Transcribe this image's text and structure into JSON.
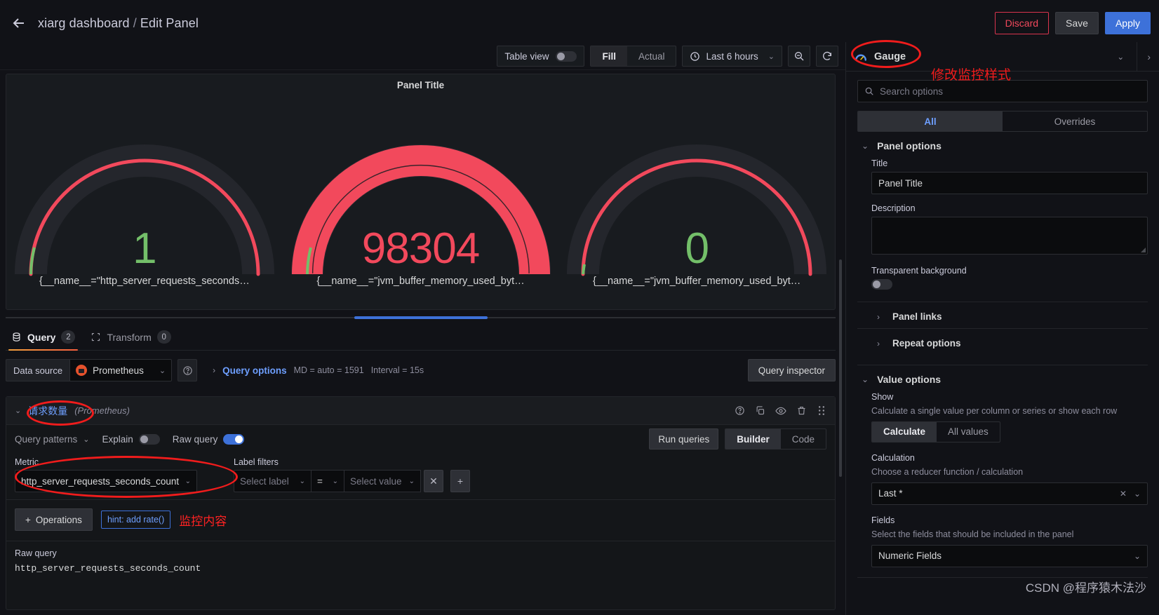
{
  "topnav": {
    "back_icon": "arrow-left-icon",
    "breadcrumb_dashboard": "xiarg dashboard",
    "breadcrumb_sep": " / ",
    "breadcrumb_page": "Edit Panel",
    "discard_label": "Discard",
    "save_label": "Save",
    "apply_label": "Apply"
  },
  "toolbar": {
    "table_view_label": "Table view",
    "table_view_on": false,
    "fill_label": "Fill",
    "actual_label": "Actual",
    "fill_active": true,
    "time_range_label": "Last 6 hours",
    "zoom_out_icon": "zoom-out-icon",
    "refresh_icon": "refresh-icon",
    "clock_icon": "clock-icon"
  },
  "panel": {
    "title": "Panel Title",
    "gauges": [
      {
        "value": "1",
        "value_color": "#73bf69",
        "label": "{__name__=\"http_server_requests_seconds…",
        "fill_percent": 2,
        "threshold_color": "#f2495c"
      },
      {
        "value": "98304",
        "value_color": "#f2495c",
        "label": "{__name__=\"jvm_buffer_memory_used_byt…",
        "fill_percent": 100,
        "threshold_color": "#f2495c"
      },
      {
        "value": "0",
        "value_color": "#73bf69",
        "label": "{__name__=\"jvm_buffer_memory_used_byt…",
        "fill_percent": 0,
        "threshold_color": "#f2495c"
      }
    ]
  },
  "query_tabs": [
    {
      "label": "Query",
      "count": "2",
      "icon": "database-icon",
      "active": true
    },
    {
      "label": "Transform",
      "count": "0",
      "icon": "transform-icon",
      "active": false
    }
  ],
  "datasource_row": {
    "label": "Data source",
    "selected": "Prometheus",
    "help_icon": "help-circle-icon",
    "query_options_label": "Query options",
    "max_data_points": "MD = auto = 1591",
    "interval": "Interval = 15s",
    "query_inspector_label": "Query inspector"
  },
  "query_editor": {
    "name": "请求数量",
    "datasource": "(Prometheus)",
    "header_icons": [
      "help-circle-icon",
      "duplicate-icon",
      "eye-icon",
      "trash-icon",
      "drag-handle-icon"
    ],
    "query_patterns_label": "Query patterns",
    "explain_label": "Explain",
    "explain_on": false,
    "raw_query_label": "Raw query",
    "raw_query_on": true,
    "run_queries_label": "Run queries",
    "builder_label": "Builder",
    "code_label": "Code",
    "mode_active": "Builder",
    "metric_label": "Metric",
    "metric_value": "http_server_requests_seconds_count",
    "label_filters_label": "Label filters",
    "select_label_placeholder": "Select label",
    "operator_value": "=",
    "select_value_placeholder": "Select value",
    "remove_filter_label": "✕",
    "add_filter_label": "+",
    "operations_label": "Operations",
    "hint_label": "hint: add rate()",
    "raw_query_section_label": "Raw query",
    "raw_query_code": "http_server_requests_seconds_count"
  },
  "options_pane": {
    "viz_name": "Gauge",
    "viz_icon": "gauge-icon",
    "search_placeholder": "Search options",
    "search_icon": "search-icon",
    "tab_all": "All",
    "tab_overrides": "Overrides",
    "tab_active": "All",
    "panel_options": {
      "section_title": "Panel options",
      "title_label": "Title",
      "title_value": "Panel Title",
      "description_label": "Description",
      "description_value": "",
      "transparent_label": "Transparent background",
      "transparent_on": false,
      "panel_links_label": "Panel links",
      "repeat_options_label": "Repeat options"
    },
    "value_options": {
      "section_title": "Value options",
      "show_label": "Show",
      "show_desc": "Calculate a single value per column or series or show each row",
      "show_calculate": "Calculate",
      "show_all_values": "All values",
      "show_active": "Calculate",
      "calculation_label": "Calculation",
      "calculation_desc": "Choose a reducer function / calculation",
      "calculation_value": "Last *",
      "fields_label": "Fields",
      "fields_desc": "Select the fields that should be included in the panel",
      "fields_value": "Numeric Fields"
    }
  },
  "annotations": {
    "viz_note": "修改监控样式",
    "content_note": "监控内容",
    "watermark": "CSDN @程序猿木法沙"
  }
}
